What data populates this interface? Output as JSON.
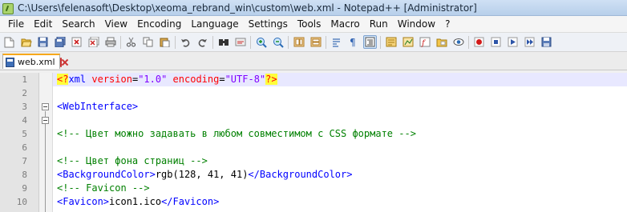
{
  "window": {
    "title": "C:\\Users\\felenasoft\\Desktop\\xeoma_rebrand_win\\custom\\web.xml - Notepad++ [Administrator]"
  },
  "menu": [
    "File",
    "Edit",
    "Search",
    "View",
    "Encoding",
    "Language",
    "Settings",
    "Tools",
    "Macro",
    "Run",
    "Window",
    "?"
  ],
  "toolbar_icons": [
    "new-file-icon",
    "open-file-icon",
    "save-icon",
    "save-all-icon",
    "close-icon",
    "close-all-icon",
    "print-icon",
    "sep",
    "cut-icon",
    "copy-icon",
    "paste-icon",
    "sep",
    "undo-icon",
    "redo-icon",
    "sep",
    "find-icon",
    "replace-icon",
    "sep",
    "zoom-in-icon",
    "zoom-out-icon",
    "sep",
    "sync-vertical-icon",
    "sync-horizontal-icon",
    "sep",
    "word-wrap-icon",
    "show-all-chars-icon",
    "indent-guide-icon",
    "sep",
    "user-language-icon",
    "document-map-icon",
    "function-list-icon",
    "folder-workspace-icon",
    "monitoring-icon",
    "sep",
    "record-macro-icon",
    "stop-macro-icon",
    "play-macro-icon",
    "run-macro-multiple-icon",
    "save-macro-icon"
  ],
  "tab": {
    "label": "web.xml",
    "icon": "xml-file-icon"
  },
  "colors": {
    "tag": "#0000ff",
    "attribute": "#ff0000",
    "value": "#8000ff",
    "comment": "#008000",
    "highlight": "#ffff3a",
    "current_line": "#e8e8ff"
  },
  "editor": {
    "line_numbers": [
      "1",
      "2",
      "3",
      "4",
      "5",
      "6",
      "7",
      "8",
      "9",
      "10"
    ],
    "lines": {
      "l1": {
        "pi_open": "<?",
        "tag": "xml",
        "a1": "version",
        "eq1": "=",
        "v1": "\"1.0\"",
        "a2": "encoding",
        "eq2": "=",
        "v2": "\"UTF-8\"",
        "pi_close": "?>"
      },
      "l3": {
        "tag": "<WebInterface>"
      },
      "l5": {
        "comment": "<!-- Цвет можно задавать в любом совместимом с CSS формате -->"
      },
      "l7": {
        "comment": "<!-- Цвет фона страниц -->"
      },
      "l8": {
        "open": "<BackgroundColor>",
        "text": "rgb(128, 41, 41)",
        "close": "</BackgroundColor>"
      },
      "l9": {
        "comment": "<!-- Favicon -->"
      },
      "l10": {
        "open": "<Favicon>",
        "text": "icon1.ico",
        "close": "</Favicon>"
      }
    }
  }
}
